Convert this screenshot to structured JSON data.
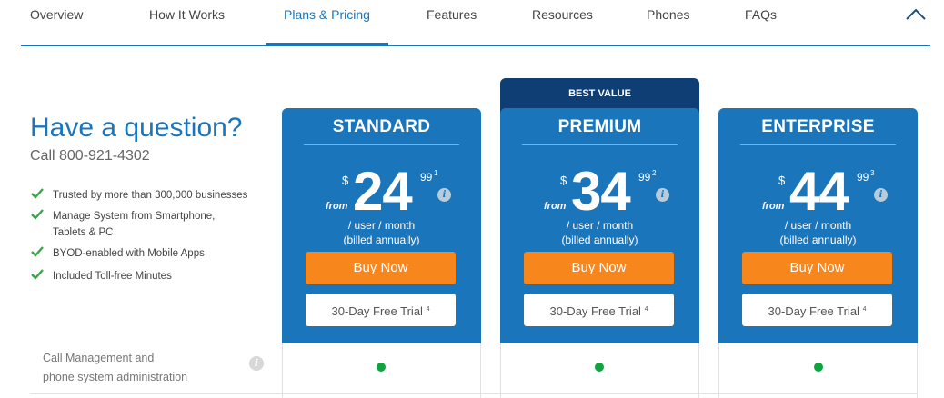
{
  "nav": {
    "tabs": [
      {
        "label": "Overview"
      },
      {
        "label": "How It Works"
      },
      {
        "label": "Plans & Pricing",
        "active": true
      },
      {
        "label": "Features"
      },
      {
        "label": "Resources"
      },
      {
        "label": "Phones"
      },
      {
        "label": "FAQs"
      }
    ],
    "collapse_icon": "chevron-up-icon"
  },
  "question": {
    "title": "Have a question?",
    "phone": "Call 800-921-4302"
  },
  "features": [
    {
      "text": "Trusted by more than 300,000 businesses",
      "icon": "checkmark-icon"
    },
    {
      "text": "Manage System from Smartphone, Tablets & PC",
      "icon": "checkmark-icon"
    },
    {
      "text": "BYOD-enabled with Mobile Apps",
      "icon": "checkmark-icon"
    },
    {
      "text": "Included Toll-free Minutes",
      "icon": "checkmark-icon"
    }
  ],
  "best_value": "BEST VALUE",
  "plans": [
    {
      "name": "STANDARD",
      "from": "from",
      "currency": "$",
      "amount": "24",
      "cents": "99",
      "footnote": "1",
      "per": "/ user / month",
      "billing": "(billed annually)",
      "buy": "Buy Now",
      "trial": "30-Day Free Trial",
      "trial_note": "4"
    },
    {
      "name": "PREMIUM",
      "from": "from",
      "currency": "$",
      "amount": "34",
      "cents": "99",
      "footnote": "2",
      "per": "/ user / month",
      "billing": "(billed annually)",
      "buy": "Buy Now",
      "trial": "30-Day Free Trial",
      "trial_note": "4"
    },
    {
      "name": "ENTERPRISE",
      "from": "from",
      "currency": "$",
      "amount": "44",
      "cents": "99",
      "footnote": "3",
      "per": "/ user / month",
      "billing": "(billed annually)",
      "buy": "Buy Now",
      "trial": "30-Day Free Trial",
      "trial_note": "4"
    }
  ],
  "comparison": {
    "row_label_line1": "Call Management and",
    "row_label_line2": "phone system administration",
    "info_icon": "i",
    "included": [
      true,
      true,
      true
    ]
  },
  "colors": {
    "accent": "#1b75bb",
    "best_value": "#0f3e74",
    "buy": "#f7861c",
    "check": "#3aa54b",
    "included_dot": "#0ea540"
  }
}
